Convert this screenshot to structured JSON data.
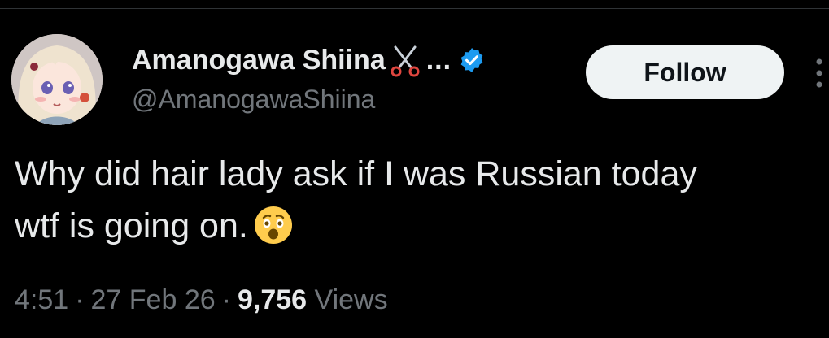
{
  "author": {
    "display_name": "Amanogawa Shiina",
    "name_truncation": "...",
    "handle": "@AmanogawaShiina",
    "verified": true,
    "avatar_icon": "anime-avatar",
    "name_emoji_icon": "scissors-icon",
    "verified_color": "#1d9bf0"
  },
  "actions": {
    "follow_label": "Follow",
    "more_icon": "more-vertical-icon"
  },
  "tweet": {
    "line1": "Why did hair lady ask if I was Russian today",
    "line2": "wtf is going on.",
    "emoji_icon": "astonished-face-emoji"
  },
  "meta": {
    "time": "4:51",
    "date": "27 Feb 26",
    "views_count": "9,756",
    "views_label": "Views",
    "separator": "·"
  },
  "colors": {
    "background": "#000000",
    "primary_text": "#e7e9ea",
    "secondary_text": "#71767b",
    "follow_bg": "#eff3f4",
    "follow_text": "#0f1419"
  }
}
